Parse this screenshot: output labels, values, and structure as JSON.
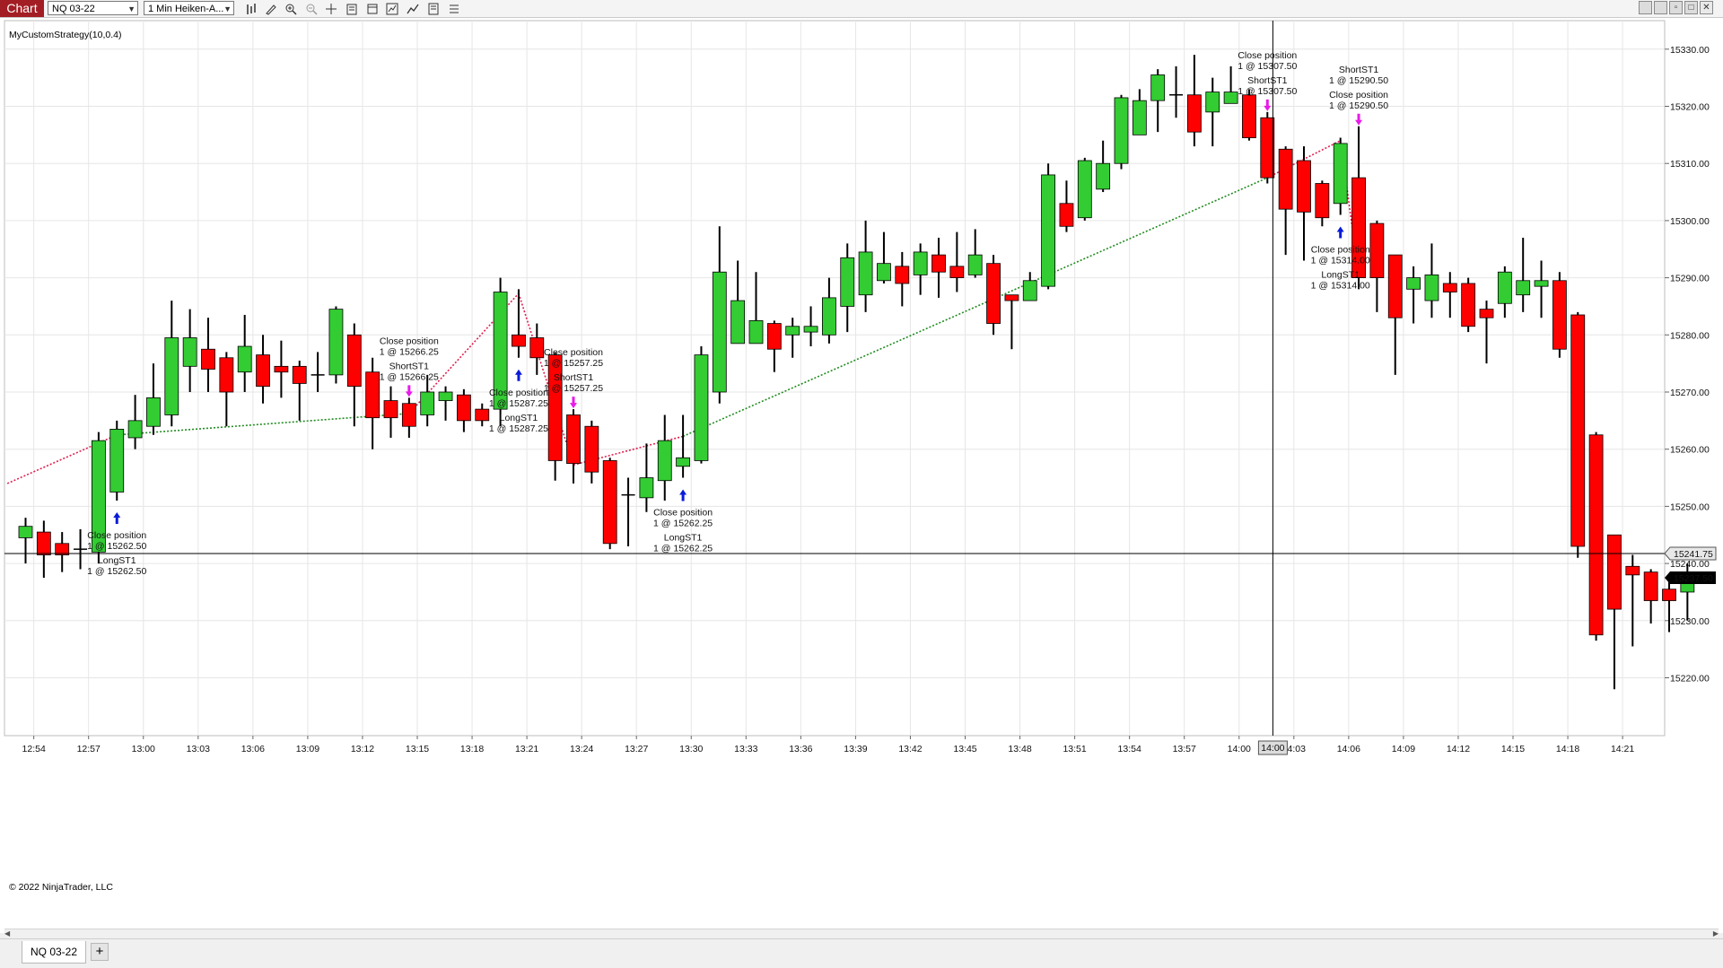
{
  "window": {
    "chart_tab": "Chart",
    "instrument_select": "NQ 03-22",
    "period_select": "1 Min Heiken-A...",
    "controls": [
      "minimize",
      "restore",
      "maximize",
      "close"
    ]
  },
  "toolbar_icons": [
    "bar-type-icon",
    "pencil-drawing-icon",
    "zoom-in-icon",
    "zoom-out-icon",
    "crosshair-icon",
    "data-box-icon",
    "properties-icon",
    "indicators-icon",
    "strategies-icon",
    "templates-icon",
    "list-icon"
  ],
  "chart": {
    "strategy_label": "MyCustomStrategy(10,0.4)",
    "copyright": "© 2022 NinjaTrader, LLC",
    "crosshair_time": "14:00",
    "crosshair_price": "15241.75",
    "last_price": "15237.50",
    "last_price_color": "#000000",
    "up_color": "#33cc33",
    "down_color": "#ff0000"
  },
  "chart_data": {
    "type": "candlestick",
    "y_axis": {
      "ticks": [
        15220.0,
        15230.0,
        15240.0,
        15250.0,
        15260.0,
        15270.0,
        15280.0,
        15290.0,
        15300.0,
        15310.0,
        15320.0,
        15330.0
      ],
      "tick_labels": [
        "15220.00",
        "15230.00",
        "15240.00",
        "15250.00",
        "15260.00",
        "15270.00",
        "15280.00",
        "15290.00",
        "15300.00",
        "15310.00",
        "15320.00",
        "15330.00"
      ],
      "range": [
        15212,
        15337
      ]
    },
    "x_axis": {
      "tick_labels": [
        "12:54",
        "12:57",
        "13:00",
        "13:03",
        "13:06",
        "13:09",
        "13:12",
        "13:15",
        "13:18",
        "13:21",
        "13:24",
        "13:27",
        "13:30",
        "13:33",
        "13:36",
        "13:39",
        "13:42",
        "13:45",
        "13:48",
        "13:51",
        "13:54",
        "13:57",
        "14:00",
        "14:03",
        "14:06",
        "14:09",
        "14:12",
        "14:15",
        "14:18",
        "14:21"
      ],
      "first_bar_time": "12:54",
      "interval_minutes": 1
    },
    "candles": [
      {
        "o": 15244.5,
        "c": 15246.5,
        "h": 15248,
        "l": 15240
      },
      {
        "o": 15245.5,
        "c": 15241.5,
        "h": 15247.5,
        "l": 15237.5
      },
      {
        "o": 15243.5,
        "c": 15241.5,
        "h": 15245.5,
        "l": 15238.5
      },
      {
        "o": 15242.5,
        "c": 15242.5,
        "h": 15246,
        "l": 15239
      },
      {
        "o": 15242,
        "c": 15261.5,
        "h": 15263,
        "l": 15240
      },
      {
        "o": 15252.5,
        "c": 15263.5,
        "h": 15265,
        "l": 15251
      },
      {
        "o": 15262,
        "c": 15265,
        "h": 15269.5,
        "l": 15260
      },
      {
        "o": 15264,
        "c": 15269,
        "h": 15275,
        "l": 15262.5
      },
      {
        "o": 15266,
        "c": 15279.5,
        "h": 15286,
        "l": 15264
      },
      {
        "o": 15274.5,
        "c": 15279.5,
        "h": 15284.5,
        "l": 15270
      },
      {
        "o": 15277.5,
        "c": 15274,
        "h": 15283,
        "l": 15270
      },
      {
        "o": 15276,
        "c": 15270,
        "h": 15277,
        "l": 15264
      },
      {
        "o": 15273.5,
        "c": 15278,
        "h": 15283.5,
        "l": 15270
      },
      {
        "o": 15276.5,
        "c": 15271,
        "h": 15280,
        "l": 15268
      },
      {
        "o": 15274.5,
        "c": 15273.5,
        "h": 15279,
        "l": 15269
      },
      {
        "o": 15274.5,
        "c": 15271.5,
        "h": 15275.5,
        "l": 15265
      },
      {
        "o": 15273,
        "c": 15273,
        "h": 15277,
        "l": 15270
      },
      {
        "o": 15273,
        "c": 15284.5,
        "h": 15285,
        "l": 15271.5
      },
      {
        "o": 15280,
        "c": 15271,
        "h": 15282,
        "l": 15264
      },
      {
        "o": 15273.5,
        "c": 15265.5,
        "h": 15276,
        "l": 15260
      },
      {
        "o": 15268.5,
        "c": 15265.5,
        "h": 15271,
        "l": 15262
      },
      {
        "o": 15268,
        "c": 15264,
        "h": 15269,
        "l": 15262
      },
      {
        "o": 15266,
        "c": 15270,
        "h": 15273,
        "l": 15264
      },
      {
        "o": 15268.5,
        "c": 15270,
        "h": 15271,
        "l": 15265
      },
      {
        "o": 15269.5,
        "c": 15265,
        "h": 15270.5,
        "l": 15263
      },
      {
        "o": 15267,
        "c": 15265,
        "h": 15268,
        "l": 15264
      },
      {
        "o": 15267,
        "c": 15287.5,
        "h": 15290,
        "l": 15264
      },
      {
        "o": 15280,
        "c": 15278,
        "h": 15288,
        "l": 15276
      },
      {
        "o": 15279.5,
        "c": 15276,
        "h": 15282,
        "l": 15273
      },
      {
        "o": 15276.5,
        "c": 15258,
        "h": 15277,
        "l": 15254.5
      },
      {
        "o": 15266,
        "c": 15257.5,
        "h": 15267,
        "l": 15254
      },
      {
        "o": 15264,
        "c": 15256,
        "h": 15265,
        "l": 15254
      },
      {
        "o": 15258,
        "c": 15243.5,
        "h": 15258.5,
        "l": 15242.5
      },
      {
        "o": 15252,
        "c": 15252,
        "h": 15255,
        "l": 15243
      },
      {
        "o": 15251.5,
        "c": 15255,
        "h": 15261,
        "l": 15249
      },
      {
        "o": 15254.5,
        "c": 15261.5,
        "h": 15266,
        "l": 15251
      },
      {
        "o": 15257,
        "c": 15258.5,
        "h": 15266,
        "l": 15255
      },
      {
        "o": 15258,
        "c": 15276.5,
        "h": 15278,
        "l": 15257.5
      },
      {
        "o": 15270,
        "c": 15291,
        "h": 15299,
        "l": 15268
      },
      {
        "o": 15278.5,
        "c": 15286,
        "h": 15293,
        "l": 15278.5
      },
      {
        "o": 15278.5,
        "c": 15282.5,
        "h": 15291,
        "l": 15278.5
      },
      {
        "o": 15282,
        "c": 15277.5,
        "h": 15282.5,
        "l": 15273.5
      },
      {
        "o": 15280,
        "c": 15281.5,
        "h": 15283,
        "l": 15276
      },
      {
        "o": 15280.5,
        "c": 15281.5,
        "h": 15285,
        "l": 15278
      },
      {
        "o": 15280,
        "c": 15286.5,
        "h": 15290,
        "l": 15278.5
      },
      {
        "o": 15285,
        "c": 15293.5,
        "h": 15296,
        "l": 15280.5
      },
      {
        "o": 15287,
        "c": 15294.5,
        "h": 15300,
        "l": 15284
      },
      {
        "o": 15289.5,
        "c": 15292.5,
        "h": 15298,
        "l": 15289
      },
      {
        "o": 15292,
        "c": 15289,
        "h": 15294.5,
        "l": 15285
      },
      {
        "o": 15290.5,
        "c": 15294.5,
        "h": 15296,
        "l": 15287
      },
      {
        "o": 15294,
        "c": 15291,
        "h": 15297,
        "l": 15286.5
      },
      {
        "o": 15292,
        "c": 15290,
        "h": 15298,
        "l": 15287.5
      },
      {
        "o": 15290.5,
        "c": 15294,
        "h": 15298.5,
        "l": 15290
      },
      {
        "o": 15292.5,
        "c": 15282,
        "h": 15294,
        "l": 15280
      },
      {
        "o": 15287,
        "c": 15286,
        "h": 15287,
        "l": 15277.5
      },
      {
        "o": 15286,
        "c": 15289.5,
        "h": 15291,
        "l": 15286
      },
      {
        "o": 15288.5,
        "c": 15308,
        "h": 15310,
        "l": 15288
      },
      {
        "o": 15303,
        "c": 15299,
        "h": 15307,
        "l": 15298
      },
      {
        "o": 15300.5,
        "c": 15310.5,
        "h": 15311,
        "l": 15300
      },
      {
        "o": 15305.5,
        "c": 15310,
        "h": 15314,
        "l": 15305
      },
      {
        "o": 15310,
        "c": 15321.5,
        "h": 15322,
        "l": 15309
      },
      {
        "o": 15315,
        "c": 15321,
        "h": 15323,
        "l": 15315
      },
      {
        "o": 15321,
        "c": 15325.5,
        "h": 15326.5,
        "l": 15315.5
      },
      {
        "o": 15322,
        "c": 15322,
        "h": 15327,
        "l": 15318
      },
      {
        "o": 15322,
        "c": 15315.5,
        "h": 15329,
        "l": 15313
      },
      {
        "o": 15319,
        "c": 15322.5,
        "h": 15325,
        "l": 15313
      },
      {
        "o": 15320.5,
        "c": 15322.5,
        "h": 15327,
        "l": 15321
      },
      {
        "o": 15322,
        "c": 15314.5,
        "h": 15323,
        "l": 15314
      },
      {
        "o": 15318,
        "c": 15307.5,
        "h": 15319,
        "l": 15306.5
      },
      {
        "o": 15312.5,
        "c": 15302,
        "h": 15313,
        "l": 15294
      },
      {
        "o": 15310.5,
        "c": 15301.5,
        "h": 15313,
        "l": 15293
      },
      {
        "o": 15306.5,
        "c": 15300.5,
        "h": 15307,
        "l": 15299
      },
      {
        "o": 15303,
        "c": 15313.5,
        "h": 15314.5,
        "l": 15301
      },
      {
        "o": 15307.5,
        "c": 15290,
        "h": 15316.5,
        "l": 15288
      },
      {
        "o": 15299.5,
        "c": 15290,
        "h": 15300,
        "l": 15284
      },
      {
        "o": 15294,
        "c": 15283,
        "h": 15294,
        "l": 15273
      },
      {
        "o": 15288,
        "c": 15290,
        "h": 15292,
        "l": 15282
      },
      {
        "o": 15286,
        "c": 15290.5,
        "h": 15296,
        "l": 15283
      },
      {
        "o": 15289,
        "c": 15287.5,
        "h": 15291,
        "l": 15283
      },
      {
        "o": 15289,
        "c": 15281.5,
        "h": 15290,
        "l": 15280.5
      },
      {
        "o": 15284.5,
        "c": 15283,
        "h": 15286,
        "l": 15275
      },
      {
        "o": 15285.5,
        "c": 15291,
        "h": 15292,
        "l": 15283
      },
      {
        "o": 15287,
        "c": 15289.5,
        "h": 15297,
        "l": 15284
      },
      {
        "o": 15288.5,
        "c": 15289.5,
        "h": 15293,
        "l": 15283
      },
      {
        "o": 15289.5,
        "c": 15277.5,
        "h": 15291,
        "l": 15276
      },
      {
        "o": 15283.5,
        "c": 15243,
        "h": 15284,
        "l": 15241
      },
      {
        "o": 15262.5,
        "c": 15227.5,
        "h": 15263,
        "l": 15226.5
      },
      {
        "o": 15245,
        "c": 15232,
        "h": 15245,
        "l": 15218
      },
      {
        "o": 15239.5,
        "c": 15238,
        "h": 15241.5,
        "l": 15225.5
      },
      {
        "o": 15238.5,
        "c": 15233.5,
        "h": 15239,
        "l": 15229.5
      },
      {
        "o": 15235.5,
        "c": 15233.5,
        "h": 15238,
        "l": 15228
      },
      {
        "o": 15235,
        "c": 15237.5,
        "h": 15240,
        "l": 15230
      }
    ],
    "executions": [
      {
        "bar": 5,
        "type": "long",
        "text": [
          "Close position",
          "1 @ 15262.50",
          "LongST1",
          "1 @ 15262.50"
        ]
      },
      {
        "bar": 21,
        "type": "short",
        "text": [
          "Close position",
          "1 @ 15266.25",
          "ShortST1",
          "1 @ 15266.25"
        ]
      },
      {
        "bar": 27,
        "type": "long",
        "text": [
          "Close position",
          "1 @ 15287.25",
          "LongST1",
          "1 @ 15287.25"
        ]
      },
      {
        "bar": 30,
        "type": "short",
        "text": [
          "Close position",
          "1 @ 15257.25",
          "ShortST1",
          "1 @ 15257.25"
        ]
      },
      {
        "bar": 36,
        "type": "long",
        "text": [
          "Close position",
          "1 @ 15262.25",
          "LongST1",
          "1 @ 15262.25"
        ]
      },
      {
        "bar": 68,
        "type": "short",
        "text": [
          "Close position",
          "1 @ 15307.50",
          "ShortST1",
          "1 @ 15307.50"
        ]
      },
      {
        "bar": 72,
        "type": "long",
        "text": [
          "Close position",
          "1 @ 15314.00",
          "LongST1",
          "1 @ 15314.00"
        ]
      },
      {
        "bar": 73,
        "type": "short",
        "text": [
          "ShortST1",
          "1 @ 15290.50",
          "Close position",
          "1 @ 15290.50"
        ]
      }
    ],
    "trade_lines": [
      {
        "from": [
          -1,
          15254
        ],
        "to": [
          5,
          15262.5
        ],
        "color": "#e0204f"
      },
      {
        "from": [
          5,
          15262.5
        ],
        "to": [
          21,
          15266.25
        ],
        "color": "#228b22"
      },
      {
        "from": [
          21,
          15266.25
        ],
        "to": [
          27,
          15287.25
        ],
        "color": "#e0204f"
      },
      {
        "from": [
          27,
          15287.25
        ],
        "to": [
          30,
          15257.25
        ],
        "color": "#e0204f"
      },
      {
        "from": [
          30,
          15257.25
        ],
        "to": [
          36,
          15262.25
        ],
        "color": "#e0204f"
      },
      {
        "from": [
          36,
          15262.25
        ],
        "to": [
          68,
          15307.5
        ],
        "color": "#228b22"
      },
      {
        "from": [
          68,
          15307.5
        ],
        "to": [
          72,
          15314
        ],
        "color": "#e0204f"
      },
      {
        "from": [
          72,
          15314
        ],
        "to": [
          73,
          15290.5
        ],
        "color": "#e0204f"
      }
    ]
  },
  "bottom_tabs": {
    "instrument_tab": "NQ 03-22",
    "add_tab": "+"
  }
}
